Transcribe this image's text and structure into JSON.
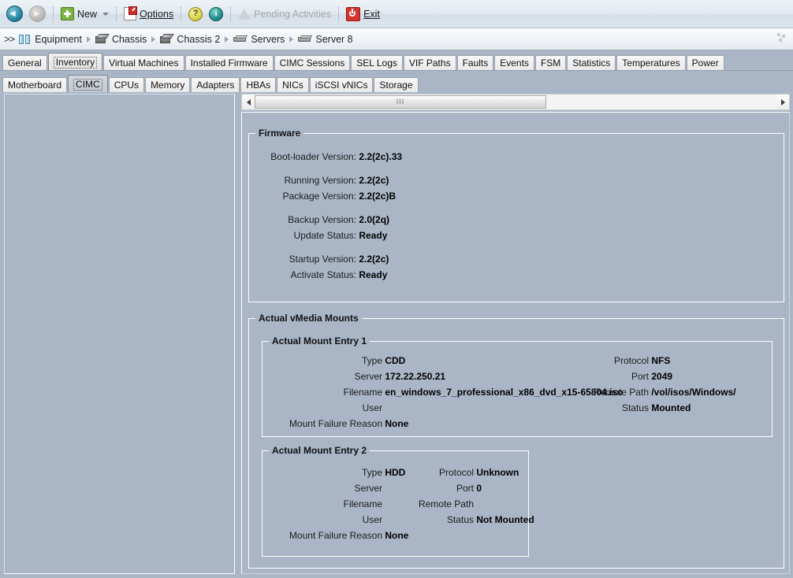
{
  "toolbar": {
    "back_icon": "back-arrow-icon",
    "forward_icon": "forward-arrow-icon",
    "new_label": "New",
    "options_label": "Options",
    "help_icon": "help-icon",
    "info_icon": "info-icon",
    "pending_label": "Pending Activities",
    "exit_label": "Exit"
  },
  "breadcrumb": {
    "prefix": ">>",
    "items": [
      {
        "label": "Equipment",
        "icon": "equipment-icon"
      },
      {
        "label": "Chassis",
        "icon": "chassis-icon"
      },
      {
        "label": "Chassis 2",
        "icon": "chassis-icon"
      },
      {
        "label": "Servers",
        "icon": "server-icon"
      },
      {
        "label": "Server 8",
        "icon": "server-icon"
      }
    ]
  },
  "tabs_primary": {
    "selected": "Inventory",
    "items": [
      "General",
      "Inventory",
      "Virtual Machines",
      "Installed Firmware",
      "CIMC Sessions",
      "SEL Logs",
      "VIF Paths",
      "Faults",
      "Events",
      "FSM",
      "Statistics",
      "Temperatures",
      "Power"
    ]
  },
  "tabs_secondary": {
    "selected": "CIMC",
    "items": [
      "Motherboard",
      "CIMC",
      "CPUs",
      "Memory",
      "Adapters",
      "HBAs",
      "NICs",
      "iSCSI vNICs",
      "Storage"
    ]
  },
  "scrollbar": {
    "left_arrow": "scroll-left-icon",
    "right_arrow": "scroll-right-icon",
    "grip": "III"
  },
  "firmware": {
    "title": "Firmware",
    "rows": [
      {
        "label": "Boot-loader Version:",
        "value": "2.2(2c).33"
      },
      {
        "label": "Running Version:",
        "value": "2.2(2c)"
      },
      {
        "label": "Package Version:",
        "value": "2.2(2c)B"
      },
      {
        "label": "Backup Version:",
        "value": "2.0(2q)"
      },
      {
        "label": "Update Status:",
        "value": "Ready"
      },
      {
        "label": "Startup Version:",
        "value": "2.2(2c)"
      },
      {
        "label": "Activate Status:",
        "value": "Ready"
      }
    ]
  },
  "vmedia": {
    "title": "Actual vMedia Mounts",
    "entry1": {
      "title": "Actual Mount Entry 1",
      "left": [
        {
          "label": "Type",
          "value": "CDD"
        },
        {
          "label": "Server",
          "value": "172.22.250.21"
        },
        {
          "label": "Filename",
          "value": "en_windows_7_professional_x86_dvd_x15-65804.iso"
        },
        {
          "label": "User",
          "value": ""
        }
      ],
      "right": [
        {
          "label": "Protocol",
          "value": "NFS"
        },
        {
          "label": "Port",
          "value": "2049"
        },
        {
          "label": "Remote Path",
          "value": "/vol/isos/Windows/"
        },
        {
          "label": "Status",
          "value": "Mounted"
        }
      ],
      "failure": {
        "label": "Mount Failure Reason",
        "value": "None"
      }
    },
    "entry2": {
      "title": "Actual Mount Entry 2",
      "left": [
        {
          "label": "Type",
          "value": "HDD"
        },
        {
          "label": "Server",
          "value": ""
        },
        {
          "label": "Filename",
          "value": ""
        },
        {
          "label": "User",
          "value": ""
        }
      ],
      "right": [
        {
          "label": "Protocol",
          "value": "Unknown"
        },
        {
          "label": "Port",
          "value": "0"
        },
        {
          "label": "Remote Path",
          "value": ""
        },
        {
          "label": "Status",
          "value": "Not Mounted"
        }
      ],
      "failure": {
        "label": "Mount Failure Reason",
        "value": "None"
      }
    }
  },
  "colors": {
    "app_background": "#aab6c6",
    "toolbar_background": "#e3eaf1",
    "accent_green": "#7cb342",
    "accent_red": "#d5342f",
    "accent_teal": "#1d8c86"
  }
}
